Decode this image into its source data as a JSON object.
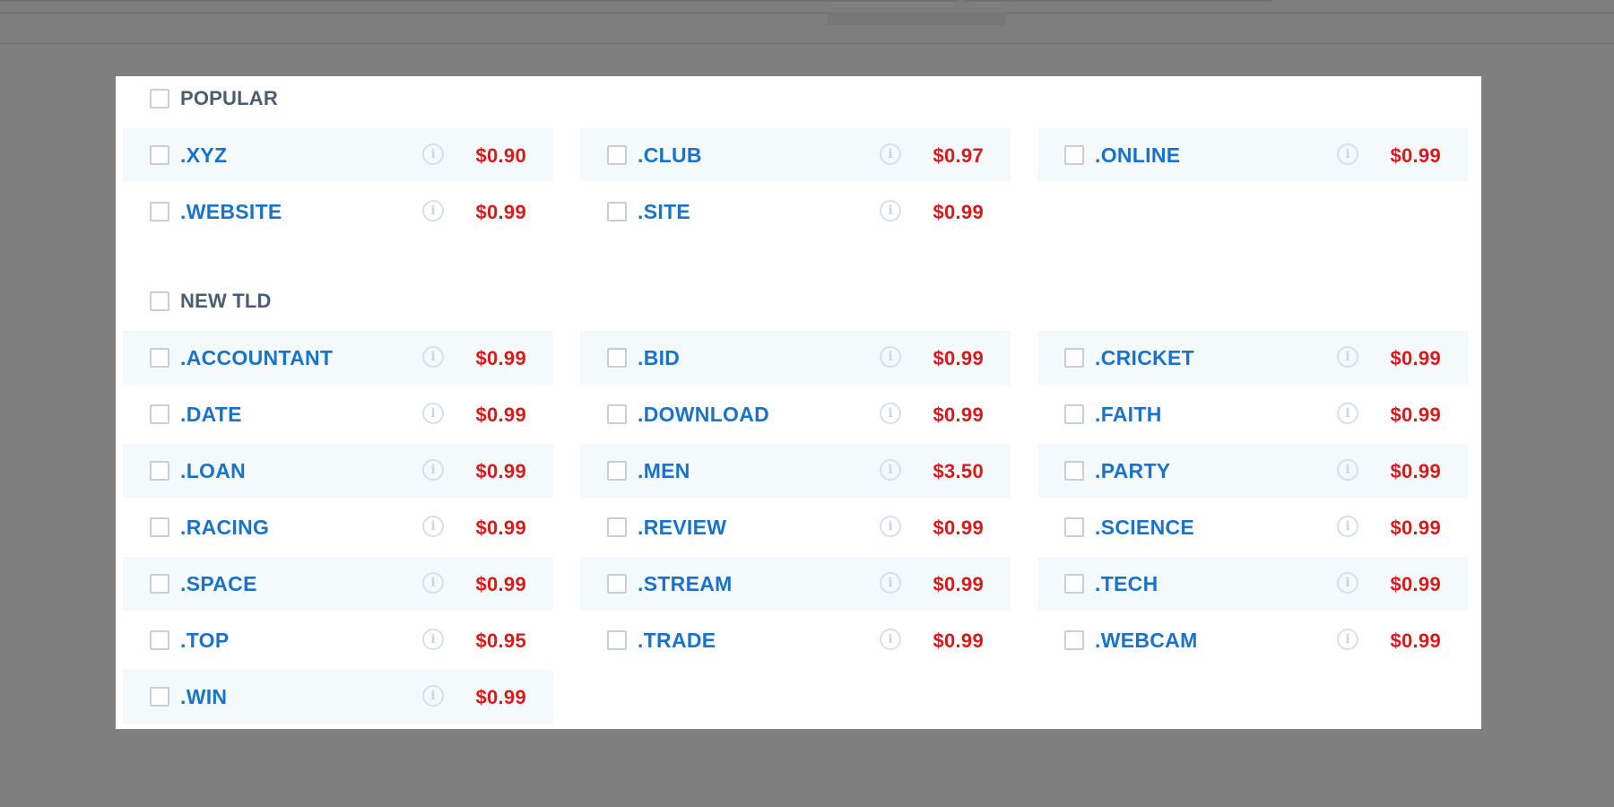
{
  "sections": [
    {
      "label": "POPULAR",
      "items": [
        {
          "name": ".XYZ",
          "price": "$0.90"
        },
        {
          "name": ".CLUB",
          "price": "$0.97"
        },
        {
          "name": ".ONLINE",
          "price": "$0.99"
        },
        {
          "name": ".WEBSITE",
          "price": "$0.99"
        },
        {
          "name": ".SITE",
          "price": "$0.99"
        }
      ]
    },
    {
      "label": "NEW TLD",
      "items": [
        {
          "name": ".ACCOUNTANT",
          "price": "$0.99"
        },
        {
          "name": ".BID",
          "price": "$0.99"
        },
        {
          "name": ".CRICKET",
          "price": "$0.99"
        },
        {
          "name": ".DATE",
          "price": "$0.99"
        },
        {
          "name": ".DOWNLOAD",
          "price": "$0.99"
        },
        {
          "name": ".FAITH",
          "price": "$0.99"
        },
        {
          "name": ".LOAN",
          "price": "$0.99"
        },
        {
          "name": ".MEN",
          "price": "$3.50"
        },
        {
          "name": ".PARTY",
          "price": "$0.99"
        },
        {
          "name": ".RACING",
          "price": "$0.99"
        },
        {
          "name": ".REVIEW",
          "price": "$0.99"
        },
        {
          "name": ".SCIENCE",
          "price": "$0.99"
        },
        {
          "name": ".SPACE",
          "price": "$0.99"
        },
        {
          "name": ".STREAM",
          "price": "$0.99"
        },
        {
          "name": ".TECH",
          "price": "$0.99"
        },
        {
          "name": ".TOP",
          "price": "$0.95"
        },
        {
          "name": ".TRADE",
          "price": "$0.99"
        },
        {
          "name": ".WEBCAM",
          "price": "$0.99"
        },
        {
          "name": ".WIN",
          "price": "$0.99"
        }
      ]
    }
  ],
  "icons": {
    "info": "info-icon"
  },
  "colors": {
    "tld_name": "#1a73c9",
    "price": "#d71a1a",
    "section_label": "#4a5d72",
    "row_shade": "#f4f9fc",
    "overlay": "#7f7f7f"
  }
}
